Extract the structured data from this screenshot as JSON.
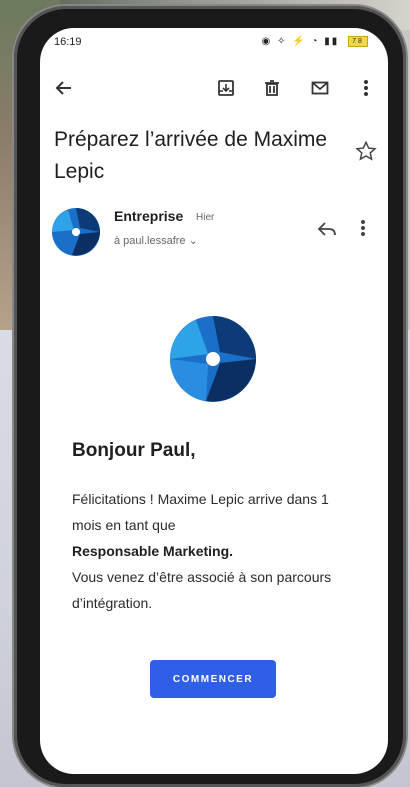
{
  "status_bar": {
    "time": "16:19",
    "icons": "◉ ✧ ⚡ ◔ ▮▮",
    "battery": "78"
  },
  "toolbar": {
    "back_icon": "arrow-left-icon",
    "archive_icon": "archive-icon",
    "delete_icon": "trash-icon",
    "mark_unread_icon": "mail-icon",
    "more_icon": "more-vertical-icon"
  },
  "email": {
    "subject": "Préparez l’arrivée de Maxime Lepic",
    "sender_name": "Entreprise",
    "sender_time": "Hier",
    "recipient": "à paul.lessafre ⌄",
    "greeting": "Bonjour Paul,",
    "body_line_1": "Félicitations ! Maxime Lepic arrive dans 1 mois en tant que",
    "body_role": "Responsable Marketing.",
    "body_line_2": "Vous venez d’être associé à son parcours d’intégration.",
    "cta_label": "COMMENCER"
  },
  "colors": {
    "cta": "#2f5fe6",
    "logo_dark": "#0d3b78",
    "logo_mid": "#1a6fc9",
    "logo_light": "#2fa3e8"
  }
}
